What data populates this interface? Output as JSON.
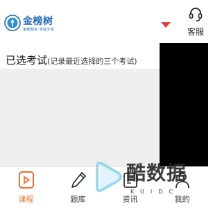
{
  "header": {
    "logo": {
      "name": "金榜树",
      "tagline": "金榜题名 学成天成"
    },
    "service_label": "客服",
    "accent_color": "#e63946"
  },
  "exams": {
    "title": "已选考试",
    "hint": "(记录最近选择的三个考试)"
  },
  "tabbar": {
    "items": [
      {
        "label": "课程",
        "icon": "play-icon",
        "active": true
      },
      {
        "label": "题库",
        "icon": "pencil-icon",
        "active": false
      },
      {
        "label": "资讯",
        "icon": "info-icon",
        "active": false
      },
      {
        "label": "我的",
        "icon": "user-icon",
        "active": false
      }
    ],
    "active_color": "#f26b2b"
  },
  "watermark": {
    "text": "酷数据",
    "sub": "KUIDC"
  }
}
